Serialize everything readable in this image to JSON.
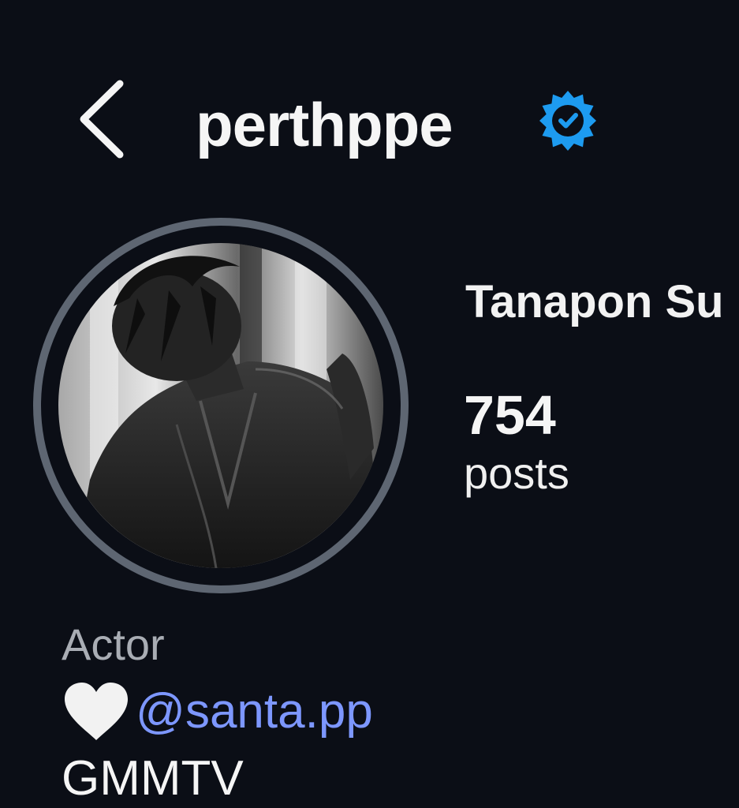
{
  "header": {
    "back_icon": "chevron-left-icon",
    "username": "perthppe",
    "verified_icon": "verified-badge-icon",
    "verified_color": "#1d9bf0"
  },
  "profile": {
    "avatar_icon": "profile-photo",
    "full_name": "Tanapon Su",
    "stats": {
      "posts_count": "754",
      "posts_label": "posts"
    },
    "bio": {
      "category": "Actor",
      "heart_icon": "white-heart-icon",
      "mention": "@santa.pp",
      "extra_line": "GMMTV"
    }
  },
  "colors": {
    "background": "#0b0e16",
    "text": "#f5f5f5",
    "muted_text": "#a9adb4",
    "link": "#7d97ff",
    "avatar_ring": "#5e6672"
  }
}
